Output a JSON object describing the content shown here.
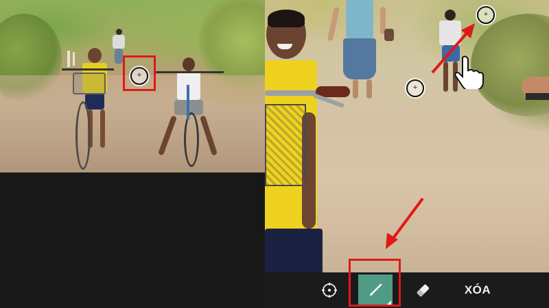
{
  "left_panel": {
    "photo": {
      "icon": "photo-children-on-bicycles"
    },
    "brush_cursor": {
      "icon": "crosshair-circle-icon"
    },
    "highlight_color": "#e01818"
  },
  "right_panel": {
    "photo": {
      "icon": "photo-zoomed-boy-with-bicycle"
    },
    "brush_cursors": [
      {
        "icon": "crosshair-circle-icon"
      },
      {
        "icon": "crosshair-circle-icon"
      }
    ],
    "hand_cursor": {
      "icon": "hand-pointer-icon"
    }
  },
  "toolbar": {
    "tools": [
      {
        "name": "target",
        "icon": "target-icon"
      },
      {
        "name": "brush",
        "icon": "brush-icon",
        "selected": true,
        "active_color": "#4f9b86"
      },
      {
        "name": "eraser",
        "icon": "eraser-icon"
      }
    ],
    "clear_label": "XÓA"
  },
  "annotation_color": "#e01818"
}
